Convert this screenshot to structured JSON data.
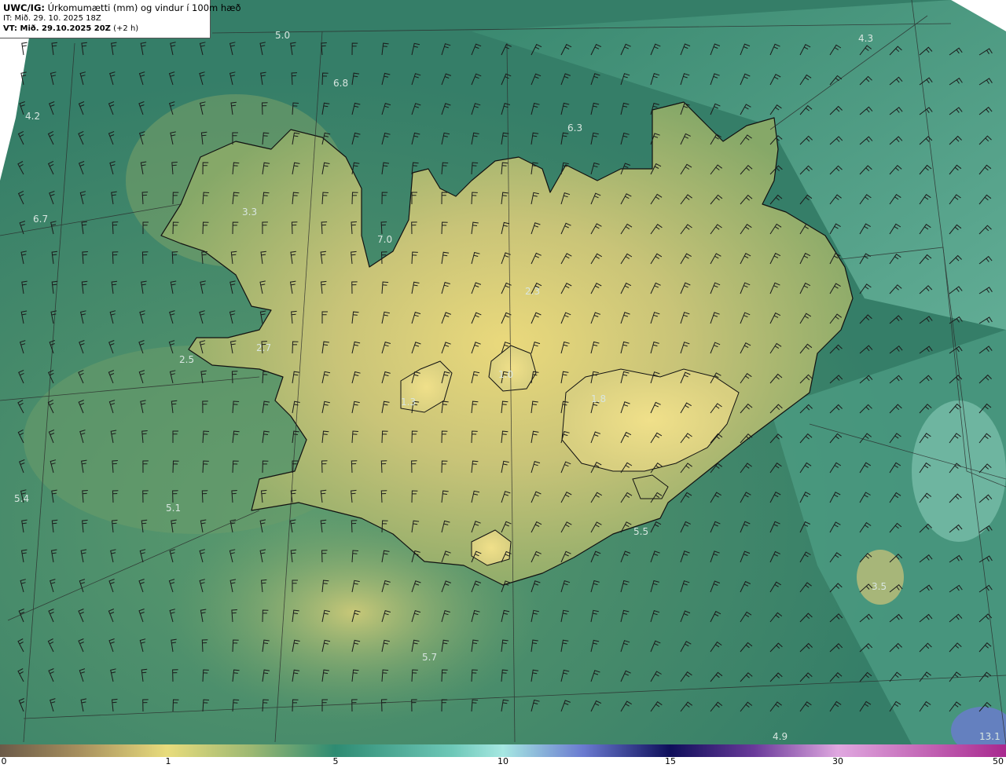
{
  "header": {
    "model": "UWC/IG:",
    "product": "Úrkomumætti (mm) og vindur í 100m hæð",
    "init_time": "IT: Mið. 29. 10. 2025 18Z",
    "valid_label": "VT: Mið. 29.10.2025 20Z",
    "valid_offset": "(+2 h)"
  },
  "map_values": [
    "5.0",
    "4.3",
    "6.8",
    "4.2",
    "6.3",
    "3.3",
    "6.7",
    "7.0",
    "2.3",
    "2.7",
    "2.5",
    "1.0",
    "1.3",
    "1.8",
    "5.4",
    "5.1",
    "5.5",
    "3.5",
    "5.7",
    "4.9",
    "13.1"
  ],
  "colorbar": {
    "ticks": [
      "0",
      "1",
      "5",
      "10",
      "15",
      "30",
      "50"
    ],
    "colors": [
      "#6b5a48",
      "#a8905e",
      "#e8dc7c",
      "#2e8b72",
      "#a6e8e2",
      "#3a3fa0",
      "#0e0e5a",
      "#c07ad0",
      "#a8288e"
    ]
  },
  "colors": {
    "sea": "#3d8a70",
    "land_low": "#7fa565",
    "land_high": "#e6dc82",
    "coast": "#111111",
    "grid": "#333333",
    "barb": "#1a1a1a"
  }
}
